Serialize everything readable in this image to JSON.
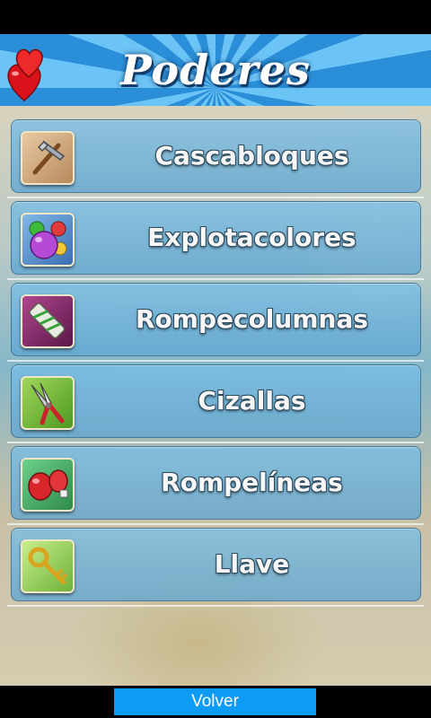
{
  "header": {
    "title": "Poderes"
  },
  "powers": [
    {
      "label": "Cascabloques",
      "icon": "hammer-icon"
    },
    {
      "label": "Explotacolores",
      "icon": "color-balloons-icon"
    },
    {
      "label": "Rompecolumnas",
      "icon": "firework-rocket-icon"
    },
    {
      "label": "Cizallas",
      "icon": "shears-icon"
    },
    {
      "label": "Rompelíneas",
      "icon": "boxing-gloves-icon"
    },
    {
      "label": "Llave",
      "icon": "key-icon"
    }
  ],
  "footer": {
    "back_label": "Volver"
  },
  "colors": {
    "banner_light": "#6cc3f5",
    "banner_dark": "#2a8fd8",
    "row_bg": "#6fb4dc",
    "back_button": "#0e9bf4"
  }
}
